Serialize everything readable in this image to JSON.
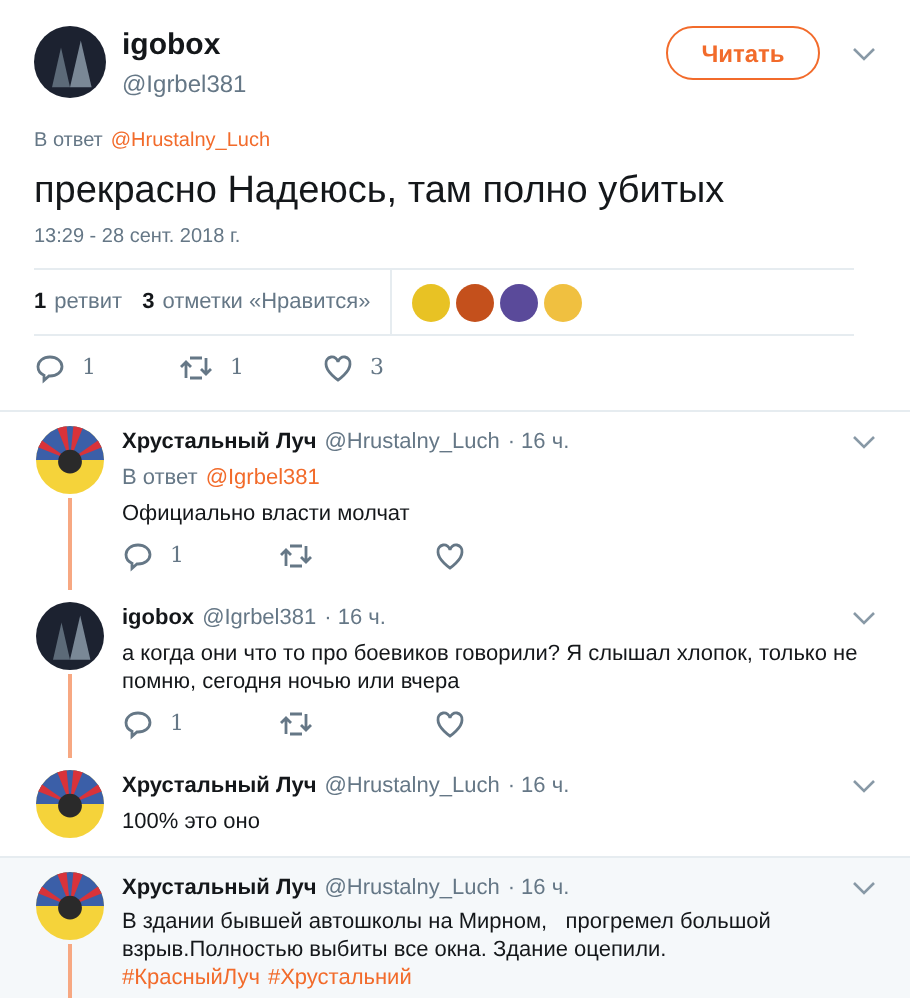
{
  "tweet": {
    "author": {
      "name": "igobox",
      "handle": "@Igrbel381",
      "avatar": {
        "kind": "dark"
      }
    },
    "follow_button": "Читать",
    "reply_to": {
      "label": "В ответ",
      "handle": "@Hrustalny_Luch"
    },
    "text": "прекрасно Надеюсь, там полно убитых",
    "timestamp": "13:29 - 28 сент. 2018 г.",
    "stats": [
      {
        "count": "1",
        "label": "ретвит"
      },
      {
        "count": "3",
        "label": "отметки «Нравится»"
      }
    ],
    "liker_avatars": [
      {
        "color": "#e8c224"
      },
      {
        "color": "#c4501c"
      },
      {
        "color": "#5a4a9a"
      },
      {
        "color": "#f0c040"
      }
    ],
    "actions": [
      {
        "kind": "reply",
        "count": "1"
      },
      {
        "kind": "retweet",
        "count": "1"
      },
      {
        "kind": "like",
        "count": "3"
      }
    ]
  },
  "replies": [
    {
      "name": "Хрустальный Луч",
      "handle": "@Hrustalny_Luch",
      "time": "· 16 ч.",
      "avatar": {
        "kind": "flag"
      },
      "highlighted": false,
      "connected_below": true,
      "reply_to": {
        "label": "В ответ",
        "handle": "@Igrbel381"
      },
      "segments": [
        {
          "kind": "plain",
          "text": "Официально власти молчат"
        }
      ],
      "actions": [
        {
          "kind": "reply",
          "count": "1"
        },
        {
          "kind": "retweet"
        },
        {
          "kind": "like"
        }
      ]
    },
    {
      "name": "igobox",
      "handle": "@Igrbel381",
      "time": "· 16 ч.",
      "avatar": {
        "kind": "dark"
      },
      "highlighted": false,
      "connected_below": true,
      "segments": [
        {
          "kind": "plain",
          "text": "а когда они что то про боевиков говорили? Я слышал хлопок, только не помню, сегодня ночью или вчера"
        }
      ],
      "actions": [
        {
          "kind": "reply",
          "count": "1"
        },
        {
          "kind": "retweet"
        },
        {
          "kind": "like"
        }
      ]
    },
    {
      "name": "Хрустальный Луч",
      "handle": "@Hrustalny_Luch",
      "time": "· 16 ч.",
      "avatar": {
        "kind": "flag"
      },
      "highlighted": false,
      "connected_below": false,
      "segments": [
        {
          "kind": "plain",
          "text": "100% это оно"
        }
      ]
    },
    {
      "name": "Хрустальный Луч",
      "handle": "@Hrustalny_Luch",
      "time": "· 16 ч.",
      "avatar": {
        "kind": "flag"
      },
      "highlighted": true,
      "connected_below": true,
      "segments": [
        {
          "kind": "plain",
          "text": "В здании бывшей автошколы на Мирном,   прогремел большой взрыв.Полностью выбиты все окна. Здание оцепили. "
        },
        {
          "kind": "hashtag",
          "text": "#КрасныйЛуч"
        },
        {
          "kind": "hashtag",
          "text": "#Хрустальний"
        }
      ]
    }
  ]
}
